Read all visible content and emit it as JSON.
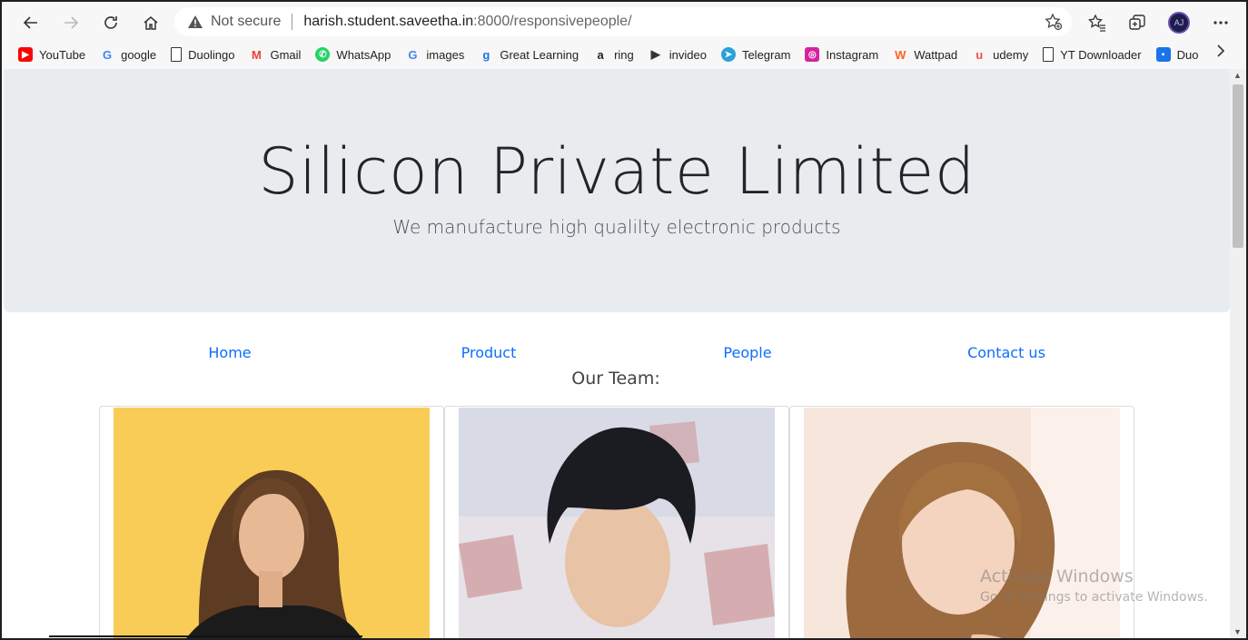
{
  "browser": {
    "address": {
      "security_label": "Not secure",
      "url_host": "harish.student.saveetha.in",
      "url_path": ":8000/responsivepeople/"
    },
    "bookmarks": [
      {
        "label": "YouTube",
        "icon": "youtube-icon",
        "color": "#ff0000"
      },
      {
        "label": "google",
        "icon": "google-icon",
        "color": "#4285f4"
      },
      {
        "label": "Duolingo",
        "icon": "page-icon",
        "color": "#ffffff"
      },
      {
        "label": "Gmail",
        "icon": "gmail-icon",
        "color": "#ea4335"
      },
      {
        "label": "WhatsApp",
        "icon": "whatsapp-icon",
        "color": "#25d366"
      },
      {
        "label": "images",
        "icon": "google-icon",
        "color": "#4285f4"
      },
      {
        "label": "Great Learning",
        "icon": "greatlearning-icon",
        "color": "#1a73e8"
      },
      {
        "label": "ring",
        "icon": "amazon-icon",
        "color": "#222222"
      },
      {
        "label": "invideo",
        "icon": "invideo-icon",
        "color": "#333333"
      },
      {
        "label": "Telegram",
        "icon": "telegram-icon",
        "color": "#2aa1da"
      },
      {
        "label": "Instagram",
        "icon": "instagram-icon",
        "color": "#d6249f"
      },
      {
        "label": "Wattpad",
        "icon": "wattpad-icon",
        "color": "#ff6122"
      },
      {
        "label": "udemy",
        "icon": "udemy-icon",
        "color": "#ec5252"
      },
      {
        "label": "YT Downloader",
        "icon": "page-icon",
        "color": "#ffffff"
      },
      {
        "label": "Duo",
        "icon": "duo-icon",
        "color": "#1a73e8"
      }
    ],
    "avatar_initials": "AJ"
  },
  "page": {
    "title": "Silicon Private Limited",
    "tagline": "We manufacture high qualilty electronic products",
    "nav": [
      "Home",
      "Product",
      "People",
      "Contact us"
    ],
    "team_heading": "Our Team:",
    "accent_color": "#0d6efd"
  },
  "watermark": {
    "line1": "Activate Windows",
    "line2": "Go to Settings to activate Windows."
  }
}
